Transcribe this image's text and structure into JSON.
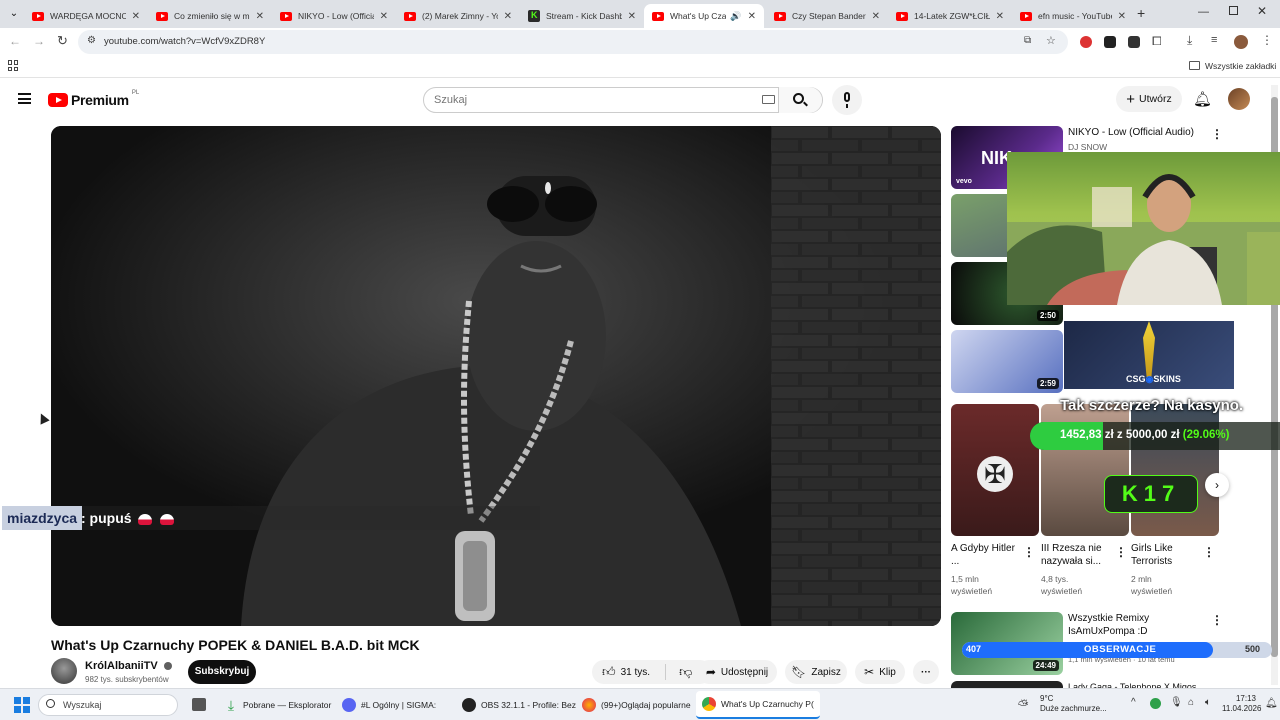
{
  "browser": {
    "tabs": [
      {
        "title": "WARDĘGA MOCNO (",
        "icon": "youtube-icon"
      },
      {
        "title": "Co zmieniło się w mo",
        "icon": "youtube-icon"
      },
      {
        "title": "NIKYO - Low (Officia",
        "icon": "youtube-icon"
      },
      {
        "title": "(2) Marek Zimny - Yo",
        "icon": "youtube-icon"
      },
      {
        "title": "Stream - Kick Dashbo",
        "icon": "kick-icon"
      },
      {
        "title": "What's Up Czarn",
        "icon": "youtube-icon",
        "active": true
      },
      {
        "title": "Czy Stepan Bandera i",
        "icon": "youtube-icon"
      },
      {
        "title": "14-Latek ZGW*ŁCIŁ S",
        "icon": "youtube-icon"
      },
      {
        "title": "efn music - YouTube",
        "icon": "youtube-icon"
      }
    ],
    "url": "youtube.com/watch?v=WcfV9xZDR8Y",
    "bookmarks_label": "Wszystkie zakładki"
  },
  "youtube": {
    "logo_text": "Premium",
    "logo_region": "PL",
    "search_placeholder": "Szukaj",
    "create_label": "Utwórz"
  },
  "video": {
    "title": "What's Up Czarnuchy POPEK & DANIEL B.A.D. bit MCK",
    "channel": "KrólAlbaniiTV",
    "subscribers": "982 tys. subskrybentów",
    "subscribe_label": "Subskrybuj",
    "likes": "31 tys.",
    "share_label": "Udostępnij",
    "save_label": "Zapisz",
    "clip_label": "Klip"
  },
  "chat_overlay": {
    "user": "miazdzyca",
    "message": ": pupuś"
  },
  "sidebar": {
    "top": {
      "title": "NIKYO - Low (Official Audio)",
      "channel": "DJ SNOW",
      "thumb_label": "NIK",
      "thumb_badge": "vevo"
    },
    "durations": [
      "2:50",
      "2:59"
    ],
    "shorts": [
      {
        "title": "A Gdyby Hitler ...",
        "views": "1,5 mln",
        "views_label": "wyświetleń"
      },
      {
        "title": "III Rzesza nie nazywała si...",
        "views": "4,8 tys.",
        "views_label": "wyświetleń"
      },
      {
        "title": "Girls Like Terrorists",
        "views": "2 mln",
        "views_label": "wyświetleń"
      }
    ],
    "remix": {
      "title": "Wszystkie Remixy IsAmUxPompa :D",
      "duration": "24:49",
      "meta": "1,1 mln wyświetleń · 10 lat temu"
    },
    "last": {
      "title": "Lady Gaga - Telephone X Migos"
    }
  },
  "stream_overlay": {
    "casino_text": "Tak szczerze? Na kasyno.",
    "balance": "1452,83 zł",
    "goal_sep": "z",
    "goal": "5000,00 zł",
    "percent": "(29.06%)",
    "csg_label": "CSG",
    "csg_label2": "SKINS",
    "kick_count": "17",
    "follow_left": "407",
    "follow_label": "OBSERWACJE",
    "follow_right": "500",
    "follow_progress": 0.81,
    "colors": {
      "green": "#2ecc40",
      "kick": "#53fc18",
      "blue": "#1e6dfc"
    }
  },
  "taskbar": {
    "search": "Wyszukaj",
    "items": [
      {
        "label": "Pobrane — Eksplorator",
        "icon": "download-icon"
      },
      {
        "label": "#L   Ogólny | SIGMA:",
        "icon": "discord-icon"
      },
      {
        "label": "OBS 32.1.1 - Profile: Bez",
        "icon": "obs-icon"
      },
      {
        "label": "(99+)Oglądaj popularne",
        "icon": "firefox-icon"
      },
      {
        "label": "What's Up Czarnuchy P(",
        "icon": "chrome-icon"
      }
    ],
    "weather_temp": "9°C",
    "weather_desc": "Duże zachmurze...",
    "time": "17:13",
    "date": "11.04.2026"
  }
}
